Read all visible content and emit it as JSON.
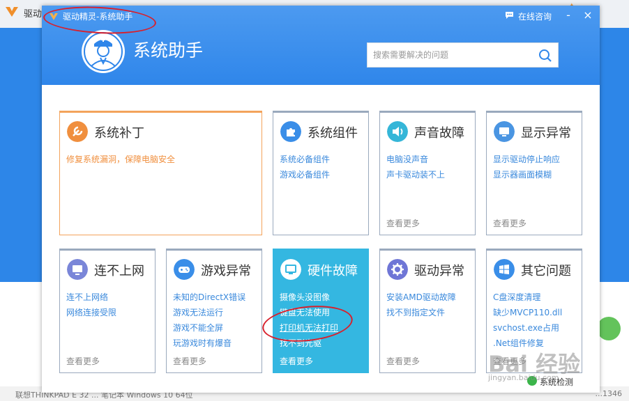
{
  "background": {
    "app_title": "驱动",
    "status_left": "联想THINKPAD E 32 ... 笔记本    Windows 10 64位",
    "status_right": "...1346"
  },
  "dialog": {
    "title": "驱动精灵-系统助手",
    "consult_label": "在线咨询",
    "minimize": "-",
    "close": "×",
    "app_name": "系统助手",
    "search_placeholder": "搜索需要解决的问题"
  },
  "cards": [
    {
      "title": "系统补丁",
      "icon": "wrench-icon",
      "items": [
        "修复系统漏洞，保障电脑安全"
      ],
      "more": ""
    },
    {
      "title": "系统组件",
      "icon": "puzzle-icon",
      "items": [
        "系统必备组件",
        "游戏必备组件"
      ],
      "more": ""
    },
    {
      "title": "声音故障",
      "icon": "speaker-icon",
      "items": [
        "电脑没声音",
        "声卡驱动装不上"
      ],
      "more": "查看更多"
    },
    {
      "title": "显示异常",
      "icon": "monitor-icon",
      "items": [
        "显示驱动停止响应",
        "显示器画面模糊"
      ],
      "more": "查看更多"
    },
    {
      "title": "连不上网",
      "icon": "network-icon",
      "items": [
        "连不上网络",
        "网络连接受限"
      ],
      "more": "查看更多"
    },
    {
      "title": "游戏异常",
      "icon": "gamepad-icon",
      "items": [
        "未知的DirectX错误",
        "游戏无法运行",
        "游戏不能全屏",
        "玩游戏时有爆音"
      ],
      "more": "查看更多"
    },
    {
      "title": "硬件故障",
      "icon": "hardware-icon",
      "items": [
        "摄像头没图像",
        "键盘无法使用",
        "打印机无法打印",
        "找不到光驱"
      ],
      "more": "查看更多"
    },
    {
      "title": "驱动异常",
      "icon": "gear-icon",
      "items": [
        "安装AMD驱动故障",
        "找不到指定文件"
      ],
      "more": "查看更多"
    },
    {
      "title": "其它问题",
      "icon": "windows-icon",
      "items": [
        "C盘深度清理",
        "缺少MVCP110.dll",
        "svchost.exe占用",
        ".Net组件修复"
      ],
      "more": "查看更多"
    }
  ],
  "footer": {
    "system_check": "系统检测"
  },
  "watermark": {
    "text": "Bai 经验",
    "sub": "jingyan.baidu.com"
  },
  "colors": {
    "header": "#2f86ea",
    "orange": "#f3a35b",
    "highlight_card": "#34b7e1",
    "link": "#3a89dc",
    "annotation": "#d8202c"
  }
}
